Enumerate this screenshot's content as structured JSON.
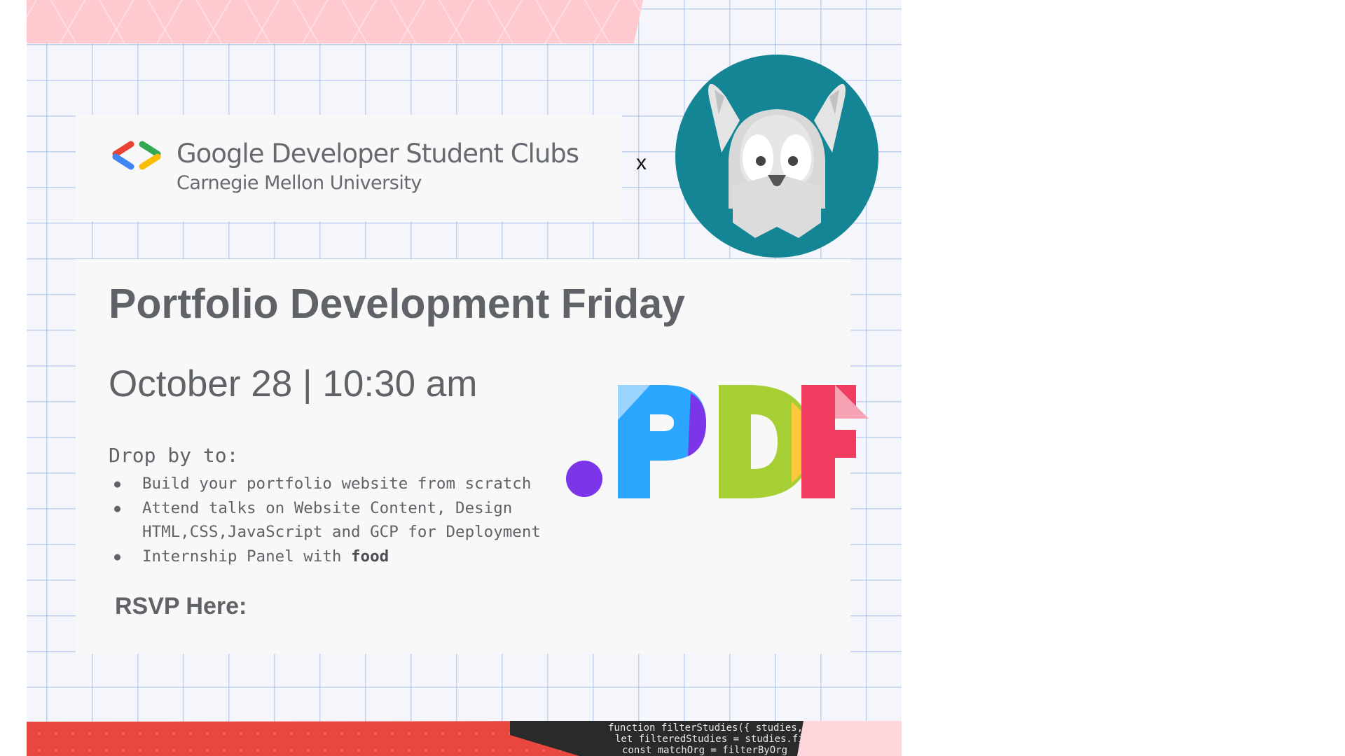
{
  "header": {
    "org_name": "Google Developer Student Clubs",
    "university": "Carnegie Mellon University",
    "cross_mark": "x"
  },
  "event": {
    "title": "Portfolio Development Friday",
    "date_time": "October 28 | 10:30 am",
    "intro": "Drop by to:",
    "bullets": {
      "b1": "Build your portfolio website from scratch",
      "b2_line1": "Attend talks on Website Content, Design",
      "b2_line2": "HTML,CSS,JavaScript and GCP for Deployment",
      "b3_prefix": "Internship Panel with ",
      "b3_bold": "food"
    },
    "rsvp": "RSVP Here:"
  },
  "graphic": {
    "pdf_label": ".PDF"
  },
  "code_snippet": {
    "line1": "function filterStudies({ studies, fil",
    "line2": "  let filteredStudies = studies.fi",
    "line3": "    const matchOrg = filterByOrg"
  },
  "colors": {
    "gdsc_blue": "#4285F4",
    "gdsc_red": "#EA4335",
    "gdsc_green": "#34A853",
    "gdsc_yellow": "#FBBC04",
    "mascot_teal": "#138594",
    "text_gray": "#5F6368"
  },
  "icons": {
    "logo": "gdsc-brackets-logo",
    "mascot": "scottie-dog-mascot",
    "graphic": "pdf-logo"
  }
}
